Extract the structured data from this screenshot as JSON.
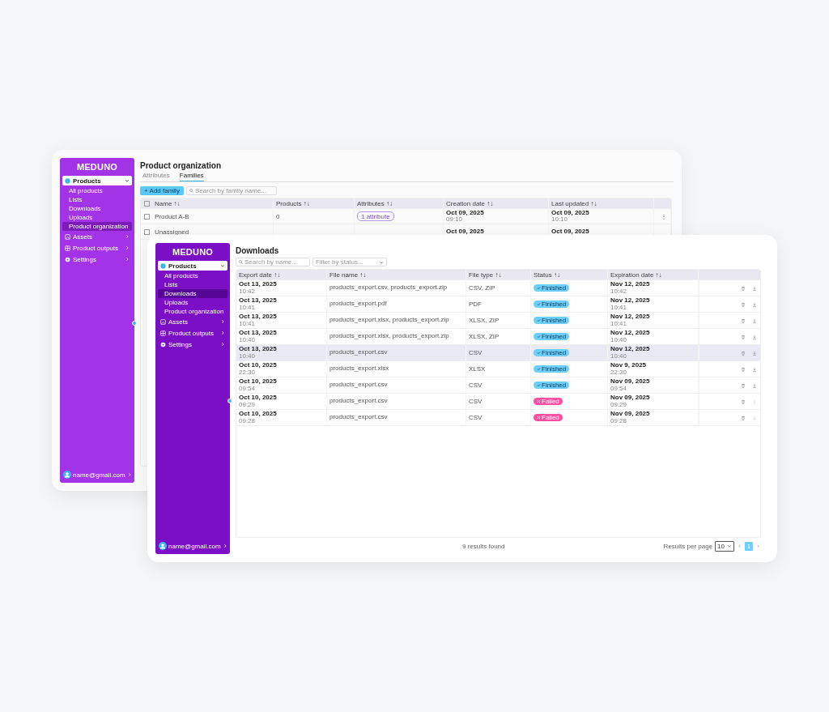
{
  "back_window": {
    "sidebar": {
      "logo": "MEDUNO",
      "nav": [
        {
          "label": "Products",
          "selected": true,
          "expanded": true,
          "children": [
            {
              "label": "All products",
              "selected": false
            },
            {
              "label": "Lists",
              "selected": false
            },
            {
              "label": "Downloads",
              "selected": false
            },
            {
              "label": "Uploads",
              "selected": false
            },
            {
              "label": "Product organization",
              "selected": true
            }
          ]
        },
        {
          "label": "Assets",
          "selected": false,
          "expanded": false
        },
        {
          "label": "Product outputs",
          "selected": false,
          "expanded": false
        },
        {
          "label": "Settings",
          "selected": false,
          "expanded": false
        }
      ],
      "user": {
        "email": "name@gmail.com"
      }
    },
    "title": "Product organization",
    "tabs": [
      {
        "label": "Attributes",
        "selected": false
      },
      {
        "label": "Families",
        "selected": true
      }
    ],
    "add_button": "+ Add family",
    "search": {
      "placeholder": "Search by family name..."
    },
    "table": {
      "select_all_checked": false,
      "columns": [
        "Name ↑↓",
        "Products ↑↓",
        "Attributes ↑↓",
        "Creation date ↑↓",
        "Last updated ↑↓"
      ],
      "rows": [
        {
          "checked": false,
          "name": "Product A-B",
          "products": "0",
          "attributes": "1 attribute",
          "created": "Oct 09, 2025",
          "created_time": "09:10",
          "updated": "Oct 09, 2025",
          "updated_time": "10:10",
          "menu": "⋮"
        },
        {
          "checked": false,
          "name": "Unassigned",
          "created": "Oct 09, 2025",
          "updated": "Oct 09, 2025"
        }
      ]
    }
  },
  "front_window": {
    "sidebar": {
      "logo": "MEDUNO",
      "nav": [
        {
          "label": "Products",
          "selected": true,
          "expanded": true,
          "children": [
            {
              "label": "All products",
              "selected": false
            },
            {
              "label": "Lists",
              "selected": false
            },
            {
              "label": "Downloads",
              "selected": true
            },
            {
              "label": "Uploads",
              "selected": false
            },
            {
              "label": "Product organization",
              "selected": false
            }
          ]
        },
        {
          "label": "Assets",
          "selected": false,
          "expanded": false
        },
        {
          "label": "Product outputs",
          "selected": false,
          "expanded": false
        },
        {
          "label": "Settings",
          "selected": false,
          "expanded": false
        }
      ],
      "user": {
        "email": "name@gmail.com"
      }
    },
    "title": "Downloads",
    "search": {
      "placeholder": "Search by name..."
    },
    "filter": {
      "placeholder": "Filter by status..."
    },
    "table": {
      "columns": [
        "Export date ↑↓",
        "File name ↑↓",
        "File type ↑↓",
        "Status ↑↓",
        "Expiration date ↑↓"
      ],
      "rows": [
        {
          "date": "Oct 13, 2025",
          "time": "10:42",
          "file": "products_export.csv, products_export.zip",
          "type": "CSV, ZIP",
          "status": {
            "kind": "finished",
            "label": "Finished"
          },
          "expires": "Nov 12, 2025",
          "expires_time": "10:42",
          "selected": false,
          "download_disabled": false
        },
        {
          "date": "Oct 13, 2025",
          "time": "10:41",
          "file": "products_export.pdf",
          "type": "PDF",
          "status": {
            "kind": "finished",
            "label": "Finished"
          },
          "expires": "Nov 12, 2025",
          "expires_time": "10:41",
          "selected": false,
          "download_disabled": false
        },
        {
          "date": "Oct 13, 2025",
          "time": "10:41",
          "file": "products_export.xlsx, products_export.zip",
          "type": "XLSX, ZIP",
          "status": {
            "kind": "finished",
            "label": "Finished"
          },
          "expires": "Nov 12, 2025",
          "expires_time": "10:41",
          "selected": false,
          "download_disabled": false
        },
        {
          "date": "Oct 13, 2025",
          "time": "10:40",
          "file": "products_export.xlsx, products_export.zip",
          "type": "XLSX, ZIP",
          "status": {
            "kind": "finished",
            "label": "Finished"
          },
          "expires": "Nov 12, 2025",
          "expires_time": "10:40",
          "selected": false,
          "download_disabled": false
        },
        {
          "date": "Oct 13, 2025",
          "time": "10:40",
          "file": "products_export.csv",
          "type": "CSV",
          "status": {
            "kind": "finished",
            "label": "Finished"
          },
          "expires": "Nov 12, 2025",
          "expires_time": "10:40",
          "selected": true,
          "download_disabled": false
        },
        {
          "date": "Oct 10, 2025",
          "time": "22:30",
          "file": "products_export.xlsx",
          "type": "XLSX",
          "status": {
            "kind": "finished",
            "label": "Finished"
          },
          "expires": "Nov 9, 2025",
          "expires_time": "22:30",
          "selected": false,
          "download_disabled": false
        },
        {
          "date": "Oct 10, 2025",
          "time": "09:54",
          "file": "products_export.csv",
          "type": "CSV",
          "status": {
            "kind": "finished",
            "label": "Finished"
          },
          "expires": "Nov 09, 2025",
          "expires_time": "09:54",
          "selected": false,
          "download_disabled": false
        },
        {
          "date": "Oct 10, 2025",
          "time": "09:29",
          "file": "products_export.csv",
          "type": "CSV",
          "status": {
            "kind": "failed",
            "label": "Failed"
          },
          "expires": "Nov 09, 2025",
          "expires_time": "09:29",
          "selected": false,
          "download_disabled": true
        },
        {
          "date": "Oct 10, 2025",
          "time": "09:28",
          "file": "products_export.csv",
          "type": "CSV",
          "status": {
            "kind": "failed",
            "label": "Failed"
          },
          "expires": "Nov 09, 2025",
          "expires_time": "09:28",
          "selected": false,
          "download_disabled": true
        }
      ]
    },
    "results": "9 results found",
    "per_page_label": "Results per page",
    "per_page": "10",
    "pagination": {
      "prev": "‹",
      "pages": [
        {
          "label": "1",
          "selected": true
        }
      ],
      "next": "›"
    }
  }
}
